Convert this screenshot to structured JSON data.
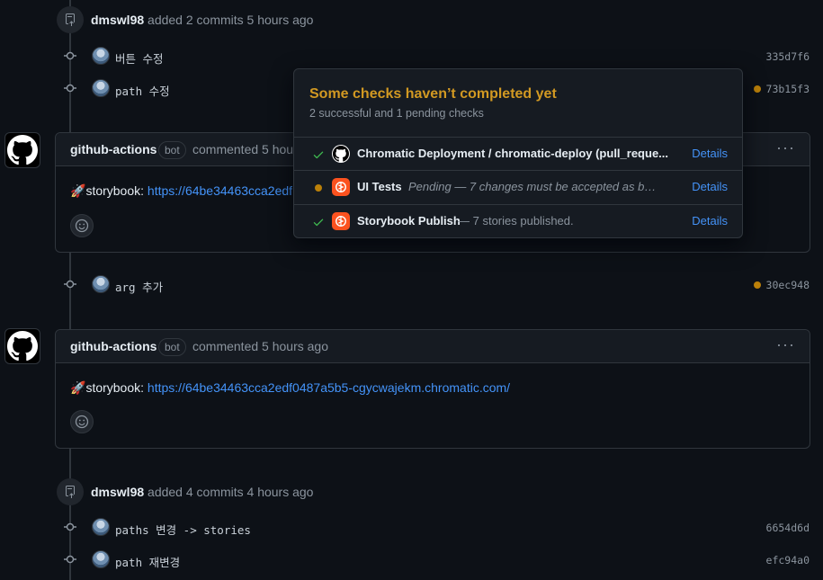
{
  "events": [
    {
      "author": "dmswl98",
      "action": "added 2 commits 5 hours ago"
    },
    {
      "author": "dmswl98",
      "action": "added 4 commits 4 hours ago"
    }
  ],
  "commits": [
    {
      "message": "버튼 수정",
      "sha": "335d7f6",
      "status": "none"
    },
    {
      "message": "path 수정",
      "sha": "73b15f3",
      "status": "pending"
    },
    {
      "message": "arg 추가",
      "sha": "30ec948",
      "status": "pending"
    },
    {
      "message": "paths 변경 -> stories",
      "sha": "6654d6d",
      "status": "none"
    },
    {
      "message": "path 재변경",
      "sha": "efc94a0",
      "status": "none"
    }
  ],
  "comments": [
    {
      "author": "github-actions",
      "badge": "bot",
      "meta": "commented 5 hours ago",
      "emoji": "🚀",
      "label": "storybook:",
      "link": "https://64be34463cca2edf0487a5b5-cgycwajekm.chromatic.com/",
      "link_visible": "https://64be34463cca2edf"
    },
    {
      "author": "github-actions",
      "badge": "bot",
      "meta": "commented 5 hours ago",
      "emoji": "🚀",
      "label": "storybook:",
      "link": "https://64be34463cca2edf0487a5b5-cgycwajekm.chromatic.com/"
    }
  ],
  "comment_partial_meta": "commented 5 hou",
  "popover": {
    "title": "Some checks haven’t completed yet",
    "subtitle": "2 successful and 1 pending checks",
    "checks": [
      {
        "status": "success",
        "app": "github-icon",
        "name": "Chromatic Deployment / chromatic-deploy (pull_reque...",
        "desc": "",
        "link": "Details"
      },
      {
        "status": "pending",
        "app": "chromatic-icon",
        "name": "UI Tests",
        "desc": "Pending — 7 changes must be accepted as bas...",
        "link": "Details"
      },
      {
        "status": "success",
        "app": "chromatic-icon",
        "name": "Storybook Publish",
        "desc": "— 7 stories published.",
        "link": "Details"
      }
    ]
  },
  "colors": {
    "pending": "#bb8009",
    "success": "#3fb950",
    "link": "#4493f8",
    "title_warning": "#d29922"
  }
}
